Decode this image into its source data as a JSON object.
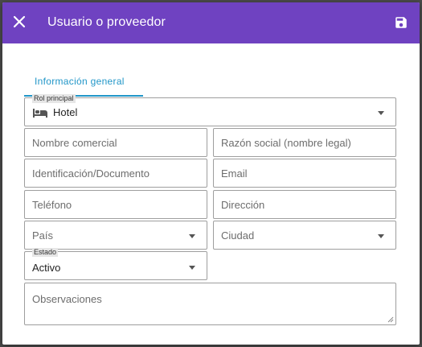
{
  "dialog": {
    "title": "Usuario o proveedor",
    "header_color": "#6f42c1"
  },
  "tabs": [
    {
      "label": "Información general",
      "active": true
    }
  ],
  "form": {
    "rol_principal": {
      "label": "Rol principal",
      "value": "Hotel",
      "icon": "bed-icon"
    },
    "nombre_comercial": {
      "placeholder": "Nombre comercial"
    },
    "razon_social": {
      "placeholder": "Razón social (nombre legal)"
    },
    "identificacion": {
      "placeholder": "Identificación/Documento"
    },
    "email": {
      "placeholder": "Email"
    },
    "telefono": {
      "placeholder": "Teléfono"
    },
    "direccion": {
      "placeholder": "Dirección"
    },
    "pais": {
      "placeholder": "País"
    },
    "ciudad": {
      "placeholder": "Ciudad"
    },
    "estado": {
      "label": "Estado",
      "value": "Activo"
    },
    "observaciones": {
      "placeholder": "Observaciones"
    }
  }
}
